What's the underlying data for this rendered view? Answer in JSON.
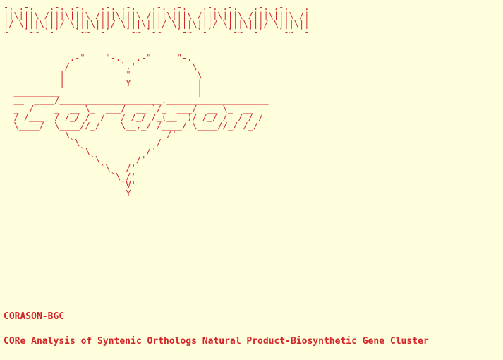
{
  "terminal": {
    "ascii_art": "-. .-.   .-. .-.   .-. .-.   .-. .-.   .-. .-.   .-. .-.   .\n||\\|||\\ /|||\\|||\\ /|||\\|||\\ /|||\\|||\\ /|||\\|||\\ /|||\\|||\\ /|\n|/ \\|||\\|||/ \\|||\\|||/ \\|||\\|||/ \\|||\\|||/ \\|||\\|||/ \\|||\\||\n~   `-~ `-`   `-~ `-`   `-~ `-~   `-~ `-`   `-~ `-`   `-~ `-\n\n\n             .-\"    \"-.   .-\"     \"-.\n            /          `.'           \\\n           |            \"             \\\n           |            Y             |\n  _________                           |\n  __  ____/____________________.____________________\n  _  /    _  __ \\_  ___/  __ `/_  ___/  __ \\_  __\n  / /___  / /_/ /  /   / /_/ /_(__  )/ /_/ /  / / /\n  \\____/  \\____//_/    \\__,_/ /____/ \\____//_/ /_/\n            \\                   /'\n             `\\               /'\n               `\\           /'\n                 `\\       /'\n                   `\\   /'\n                     `\\ /'\n                       `V'\n                        Y",
    "title": "CORASON-BGC",
    "subtitle": "CORe Analysis of Syntenic Orthologs Natural Product-Biosynthetic Gene Cluster",
    "text_color": "#d3262a",
    "background_color": "#ffffdd"
  }
}
